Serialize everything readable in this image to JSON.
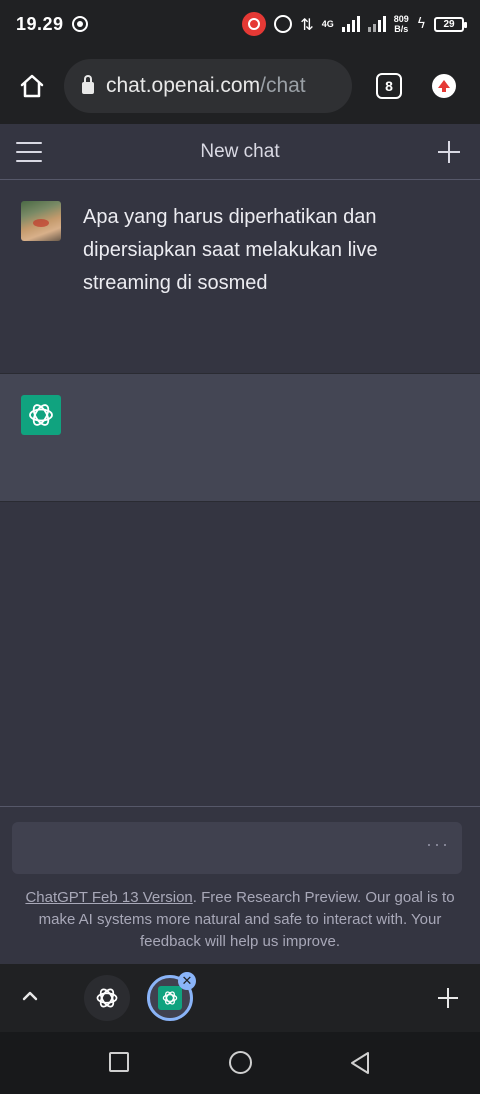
{
  "status_bar": {
    "time": "19.29",
    "network_type": "4G",
    "speed_value": "809",
    "speed_unit": "B/s",
    "battery": "29"
  },
  "browser": {
    "url_host": "chat.openai.com",
    "url_path": "/chat",
    "tab_count": "8"
  },
  "chat": {
    "title": "New chat"
  },
  "messages": [
    {
      "role": "user",
      "text": "Apa yang harus diperhatikan dan dipersiapkan saat melakukan live streaming di sosmed"
    },
    {
      "role": "assistant",
      "text": ""
    }
  ],
  "input": {
    "value": "",
    "more_label": "···"
  },
  "footer": {
    "link_text": "ChatGPT Feb 13 Version",
    "text": ". Free Research Preview. Our goal is to make AI systems more natural and safe to interact with. Your feedback will help us improve."
  },
  "tab_strip": {
    "close_label": "✕"
  },
  "colors": {
    "accent": "#10a37f",
    "background": "#343541",
    "assistant_row": "#444654",
    "input": "#40414f",
    "browser_chrome": "#202123",
    "tab_highlight": "#8ab4f8"
  },
  "icons": [
    "target-icon",
    "screen-record-icon",
    "alarm-icon",
    "data-arrows-icon",
    "signal-icon",
    "charging-icon",
    "battery-icon",
    "home-icon",
    "lock-icon",
    "tabs-icon",
    "upload-icon",
    "menu-icon",
    "plus-icon",
    "chatgpt-logo-icon",
    "more-icon",
    "chevron-up-icon",
    "close-icon",
    "square-icon",
    "circle-icon",
    "back-icon"
  ]
}
